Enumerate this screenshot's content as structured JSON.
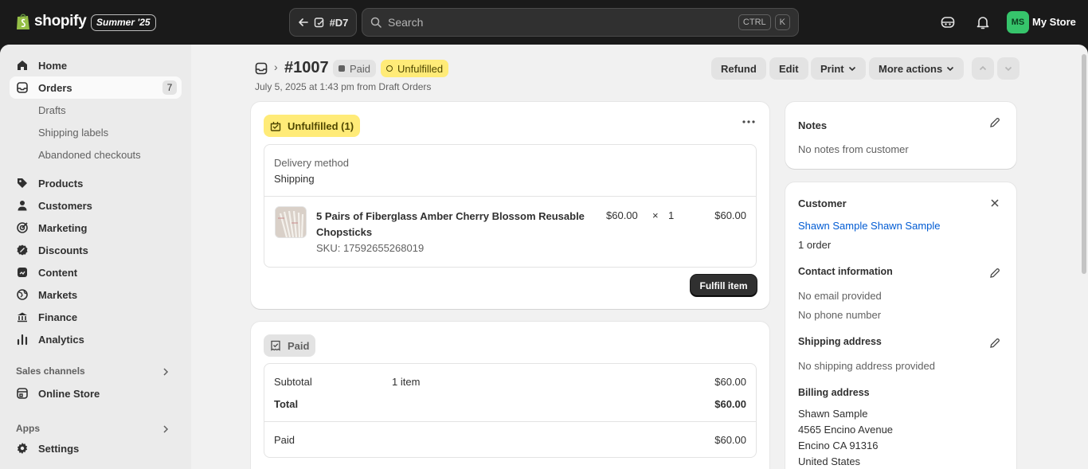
{
  "topbar": {
    "logo_text": "shopify",
    "edition": "Summer '25",
    "nav_pill_label": "#D7",
    "search_placeholder": "Search",
    "kbd_ctrl": "CTRL",
    "kbd_k": "K",
    "store_initials": "MS",
    "store_name": "My Store"
  },
  "sidebar": {
    "home": "Home",
    "orders": "Orders",
    "orders_count": "7",
    "drafts": "Drafts",
    "shipping_labels": "Shipping labels",
    "abandoned": "Abandoned checkouts",
    "products": "Products",
    "customers": "Customers",
    "marketing": "Marketing",
    "discounts": "Discounts",
    "content": "Content",
    "markets": "Markets",
    "finance": "Finance",
    "analytics": "Analytics",
    "sales_channels": "Sales channels",
    "online_store": "Online Store",
    "apps": "Apps",
    "settings": "Settings"
  },
  "header": {
    "separator": "›",
    "order_number": "#1007",
    "paid_badge": "Paid",
    "unfulfilled_badge": "Unfulfilled",
    "meta": "July 5, 2025 at 1:43 pm from Draft Orders",
    "refund": "Refund",
    "edit": "Edit",
    "print": "Print",
    "more_actions": "More actions"
  },
  "fulfillment_card": {
    "status": "Unfulfilled (1)",
    "delivery_label": "Delivery method",
    "delivery_value": "Shipping",
    "item_title_line1": "5 Pairs of Fiberglass Amber Cherry Blossom Reusable",
    "item_title_line2": "Chopsticks",
    "sku": "SKU: 17592655268019",
    "unit_price": "$60.00",
    "times": "×",
    "quantity": "1",
    "line_total": "$60.00",
    "fulfill_button": "Fulfill item"
  },
  "payment_card": {
    "status": "Paid",
    "subtotal_label": "Subtotal",
    "subtotal_items": "1 item",
    "subtotal_value": "$60.00",
    "total_label": "Total",
    "total_value": "$60.00",
    "paid_label": "Paid",
    "paid_value": "$60.00"
  },
  "notes_card": {
    "title": "Notes",
    "body": "No notes from customer"
  },
  "customer_card": {
    "title": "Customer",
    "name": "Shawn Sample Shawn Sample",
    "orders": "1 order",
    "contact_title": "Contact information",
    "no_email": "No email provided",
    "no_phone": "No phone number",
    "shipping_title": "Shipping address",
    "no_shipping": "No shipping address provided",
    "billing_title": "Billing address",
    "billing_name": "Shawn Sample",
    "billing_street": "4565 Encino Avenue",
    "billing_city": "Encino CA 91316",
    "billing_country": "United States"
  },
  "colors": {
    "unfulfilled_bg": "#ffeb78",
    "paid_bg": "#e3e3e3",
    "link": "#005bd3",
    "brand_green": "#36c46b"
  }
}
